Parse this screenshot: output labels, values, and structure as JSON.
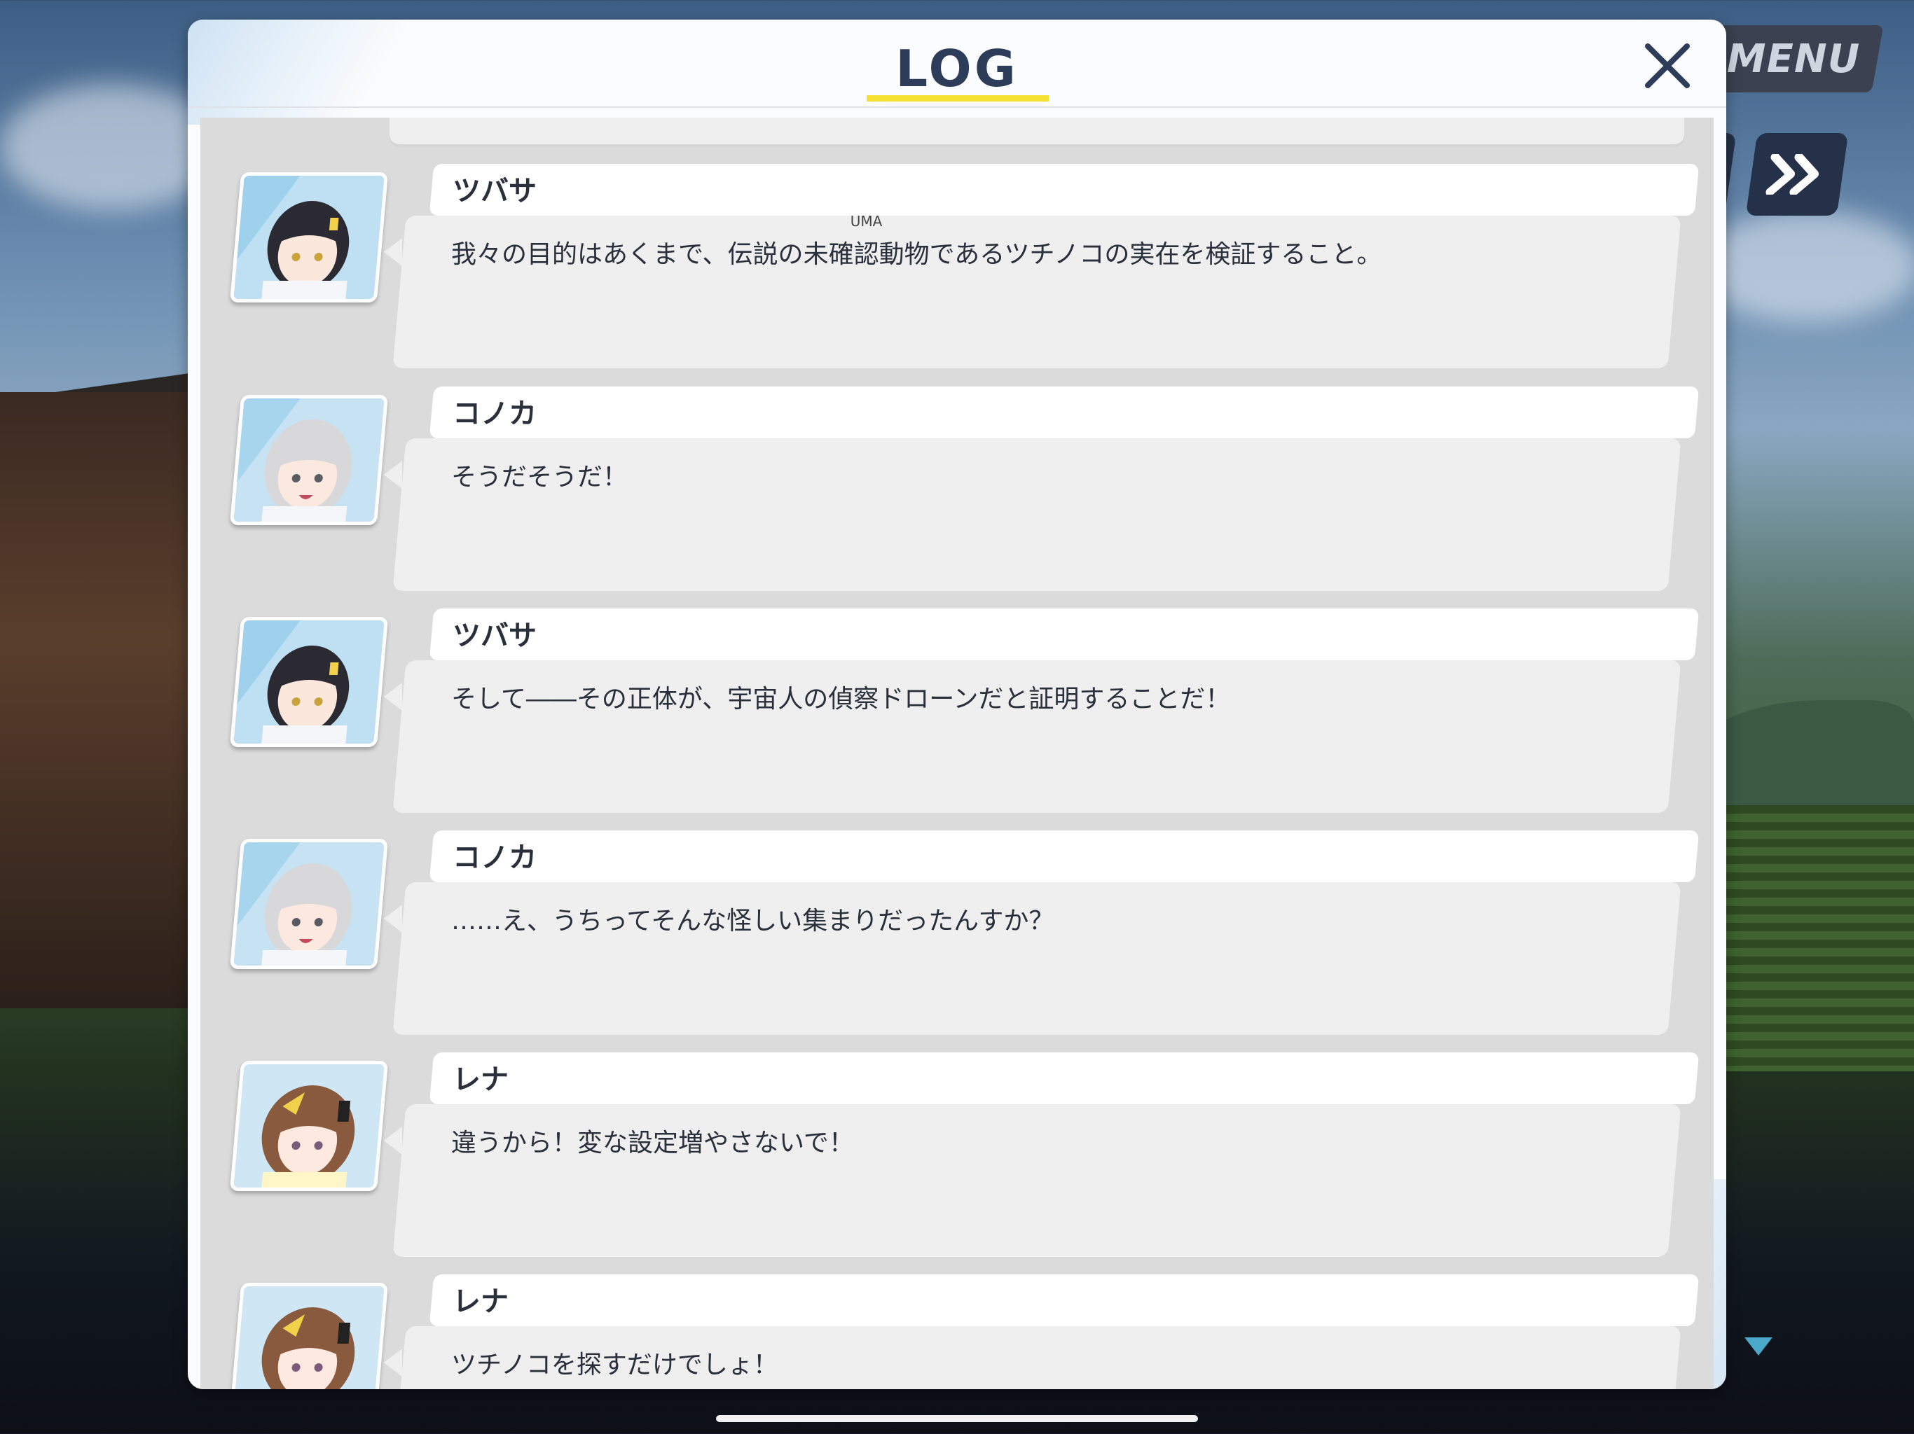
{
  "menu": {
    "label": "MENU"
  },
  "log": {
    "title": "LOG",
    "entries": [
      {
        "speaker": "ツバサ",
        "text_before": "我々の目的はあくまで、伝説の",
        "ruby_base": "未確認動物",
        "ruby_text": "UMA",
        "text_after": "であるツチノコの実在を検証すること。",
        "avatar": "tsubasa-portrait"
      },
      {
        "speaker": "コノカ",
        "text": "そうだそうだ！",
        "avatar": "konoka-portrait"
      },
      {
        "speaker": "ツバサ",
        "text": "そして――その正体が、宇宙人の偵察ドローンだと証明することだ！",
        "avatar": "tsubasa-portrait"
      },
      {
        "speaker": "コノカ",
        "text": "……え、うちってそんな怪しい集まりだったんすか？",
        "avatar": "konoka-portrait"
      },
      {
        "speaker": "レナ",
        "text": "違うから！変な設定増やさないで！",
        "avatar": "rena-portrait"
      },
      {
        "speaker": "レナ",
        "text": "ツチノコを探すだけでしょ！",
        "avatar": "rena-portrait"
      }
    ]
  },
  "colors": {
    "title": "#2d3c58",
    "underline": "#f4e030",
    "bubble": "#efefef"
  }
}
